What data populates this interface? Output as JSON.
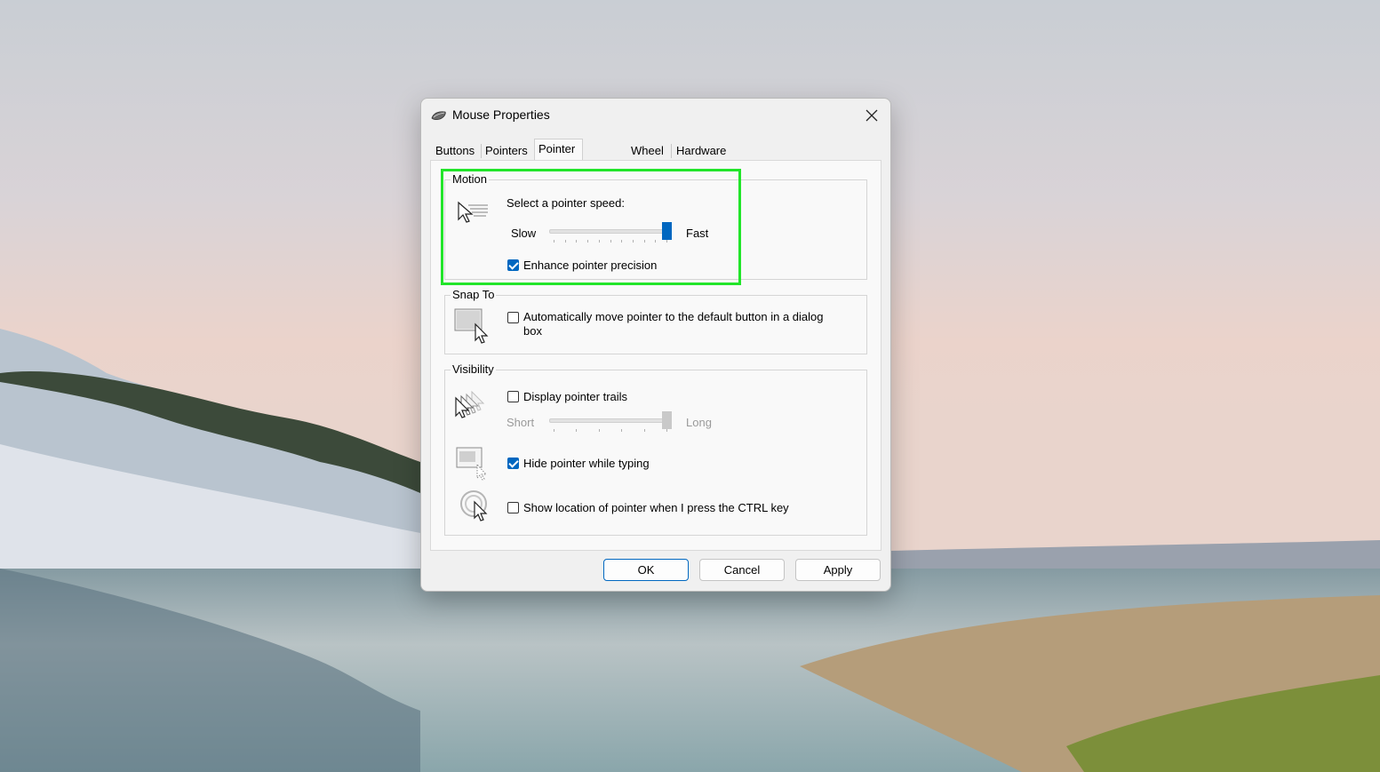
{
  "window": {
    "title": "Mouse Properties"
  },
  "tabs": [
    {
      "label": "Buttons",
      "active": false
    },
    {
      "label": "Pointers",
      "active": false
    },
    {
      "label": "Pointer Options",
      "active": true
    },
    {
      "label": "Wheel",
      "active": false
    },
    {
      "label": "Hardware",
      "active": false
    }
  ],
  "motion": {
    "group_title": "Motion",
    "speed_label": "Select a pointer speed:",
    "slow_label": "Slow",
    "fast_label": "Fast",
    "speed_value_fraction": 1.0,
    "enhance_precision_label": "Enhance pointer precision",
    "enhance_precision_checked": true
  },
  "snap_to": {
    "group_title": "Snap To",
    "auto_move_label_line1": "Automatically move pointer to the default button in a dialog",
    "auto_move_label_line2": "box",
    "auto_move_checked": false
  },
  "visibility": {
    "group_title": "Visibility",
    "trails_label": "Display pointer trails",
    "trails_checked": false,
    "short_label": "Short",
    "long_label": "Long",
    "trails_value_fraction": 1.0,
    "hide_typing_label": "Hide pointer while typing",
    "hide_typing_checked": true,
    "show_location_label": "Show location of pointer when I press the CTRL key",
    "show_location_checked": false
  },
  "buttons": {
    "ok": "OK",
    "cancel": "Cancel",
    "apply": "Apply"
  },
  "colors": {
    "accent": "#0067c0",
    "highlight": "#22e52a"
  },
  "icons": {
    "app": "mouse-icon",
    "close": "close-icon",
    "motion": "pointer-speed-icon",
    "snap": "snap-to-default-icon",
    "trails": "pointer-trails-icon",
    "hide": "hide-pointer-icon",
    "location": "pointer-location-icon"
  }
}
